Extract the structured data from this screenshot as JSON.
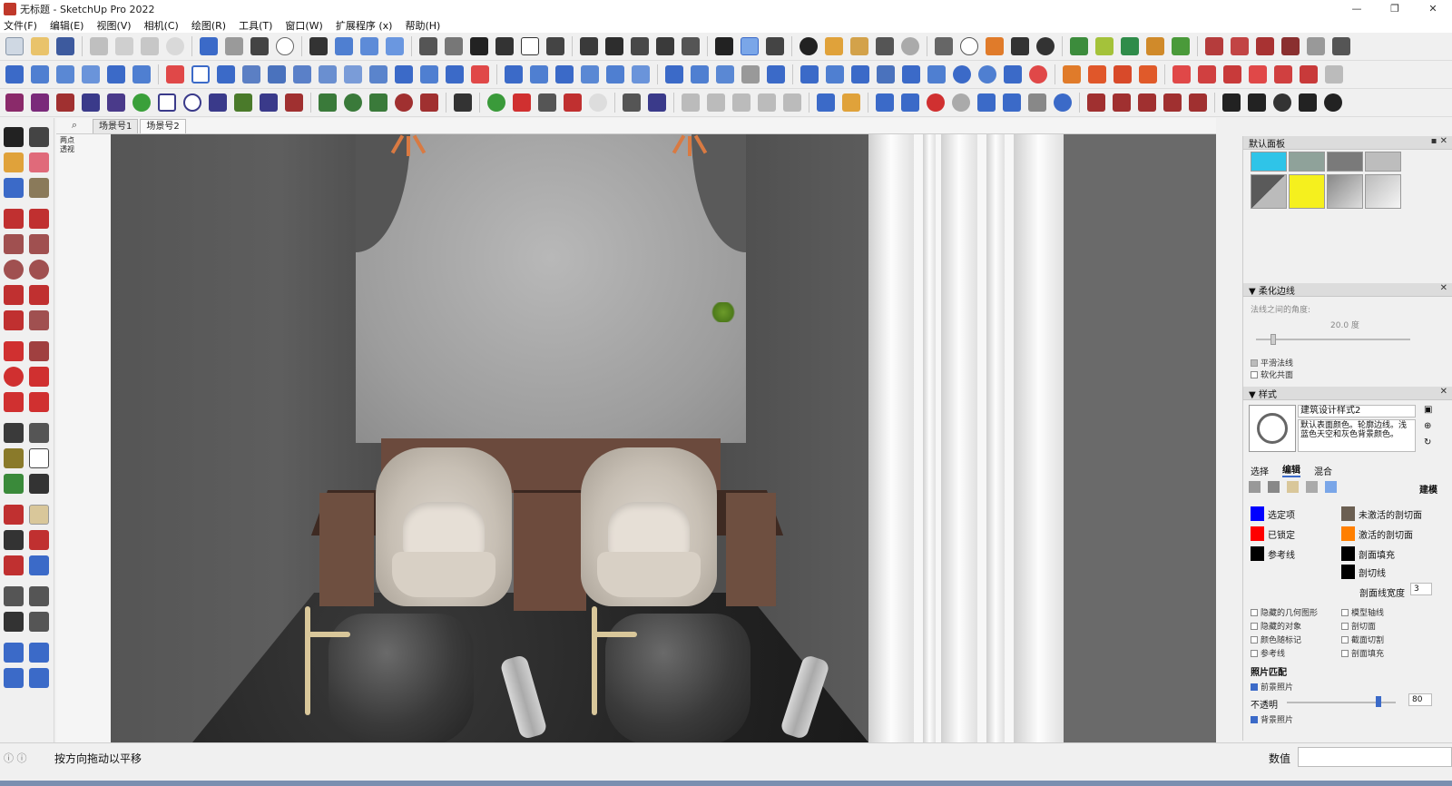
{
  "window": {
    "title": "无标题 - SketchUp Pro 2022",
    "controls": [
      "—",
      "❐",
      "✕"
    ]
  },
  "menu": [
    "文件(F)",
    "编辑(E)",
    "视图(V)",
    "相机(C)",
    "绘图(R)",
    "工具(T)",
    "窗口(W)",
    "扩展程序 (x)",
    "帮助(H)"
  ],
  "scenes": {
    "search_icon": "⌕",
    "tabs": [
      "场景号1",
      "场景号2"
    ]
  },
  "viewport": {
    "label_line1": "两点",
    "label_line2": "透视"
  },
  "tray": {
    "default_panel": "默认面板",
    "soften": {
      "title": "▼ 柔化边线",
      "angle_label": "法线之间的角度:",
      "angle_value": "20.0 度",
      "smooth_normals": "平滑法线",
      "soften_coplanar": "软化共面"
    },
    "styles": {
      "title": "▼ 样式",
      "style_name": "建筑设计样式2",
      "style_desc": "默认表面颜色。轮廓边线。浅蓝色天空和灰色背景颜色。",
      "tabs": [
        "选择",
        "编辑",
        "混合"
      ],
      "modeling_label": "建模",
      "colors": [
        {
          "label": "选定项",
          "color": "#0000ff"
        },
        {
          "label": "已锁定",
          "color": "#ff0000"
        },
        {
          "label": "参考线",
          "color": "#000000"
        },
        {
          "label": "未激活的剖切面",
          "color": "#6b5f52"
        },
        {
          "label": "激活的剖切面",
          "color": "#ff7f00"
        },
        {
          "label": "剖面填充",
          "color": "#000000"
        },
        {
          "label": "剖切线",
          "color": "#000000"
        }
      ],
      "section_width_label": "剖面线宽度",
      "section_width_value": "3",
      "checks_left": [
        "隐藏的几何图形",
        "隐藏的对象",
        "颜色随标记",
        "参考线"
      ],
      "checks_right": [
        "模型轴线",
        "剖切面",
        "截面切割",
        "剖面填充"
      ],
      "photo_match": "照片匹配",
      "foreground_photo": "前景照片",
      "opacity_label": "不透明",
      "opacity_value": "80",
      "background_photo": "背景照片"
    }
  },
  "status": {
    "message": "按方向拖动以平移",
    "value_label": "数值"
  },
  "colors": {
    "accent": "#3b6ac8",
    "wood": "#6b4a3d",
    "wall": "#9d9d9d"
  }
}
